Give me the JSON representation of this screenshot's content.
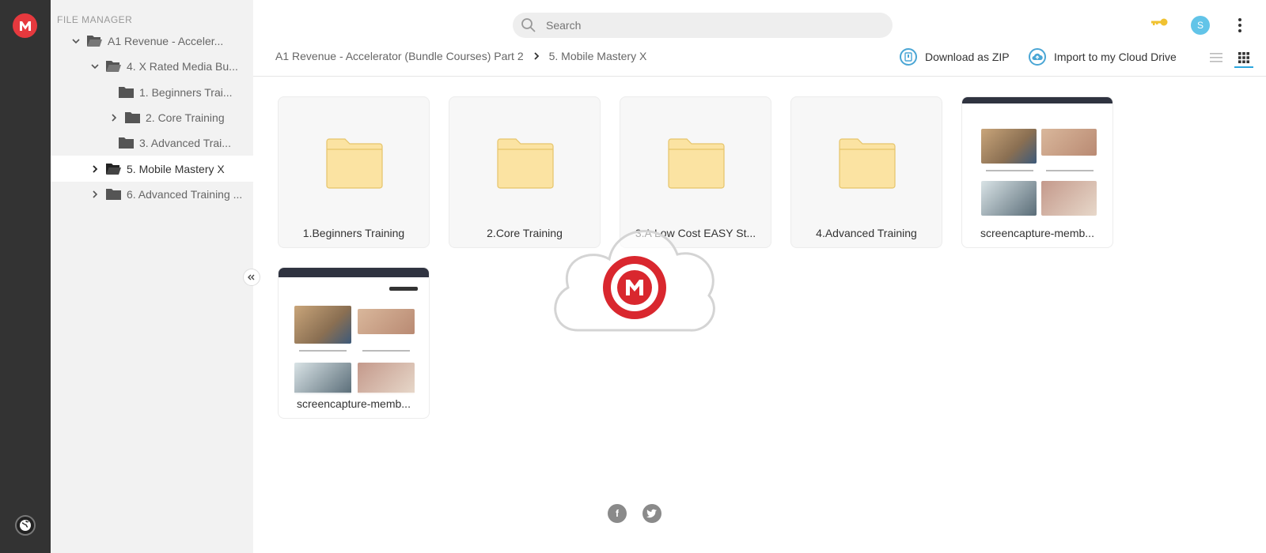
{
  "sidebar": {
    "title": "FILE MANAGER",
    "items": [
      {
        "label": "A1 Revenue - Acceler..."
      },
      {
        "label": "4. X Rated Media Bu..."
      },
      {
        "label": "1. Beginners Trai..."
      },
      {
        "label": "2. Core Training"
      },
      {
        "label": "3. Advanced Trai..."
      },
      {
        "label": "5. Mobile Mastery X"
      },
      {
        "label": "6. Advanced Training ..."
      }
    ]
  },
  "search": {
    "placeholder": "Search"
  },
  "account": {
    "avatar_letter": "S"
  },
  "breadcrumb": {
    "parent": "A1 Revenue - Accelerator (Bundle Courses) Part 2",
    "current": "5. Mobile Mastery X"
  },
  "actions": {
    "download_zip": "Download as ZIP",
    "import_cloud": "Import to my Cloud Drive"
  },
  "files": [
    {
      "name": "1.Beginners Training",
      "type": "folder"
    },
    {
      "name": "2.Core Training",
      "type": "folder"
    },
    {
      "name": "3.A Low Cost EASY St...",
      "type": "folder"
    },
    {
      "name": "4.Advanced Training",
      "type": "folder"
    },
    {
      "name": "screencapture-memb...",
      "type": "image"
    },
    {
      "name": "screencapture-memb...",
      "type": "image"
    }
  ],
  "icons": {
    "brand": "mega-logo-icon",
    "key": "key-icon",
    "facebook_letter": "f"
  },
  "colors": {
    "brand_red": "#e6393e",
    "accent_blue": "#2ba6de",
    "folder_yellow": "#fbe3a2",
    "key_gold": "#f0c231"
  }
}
